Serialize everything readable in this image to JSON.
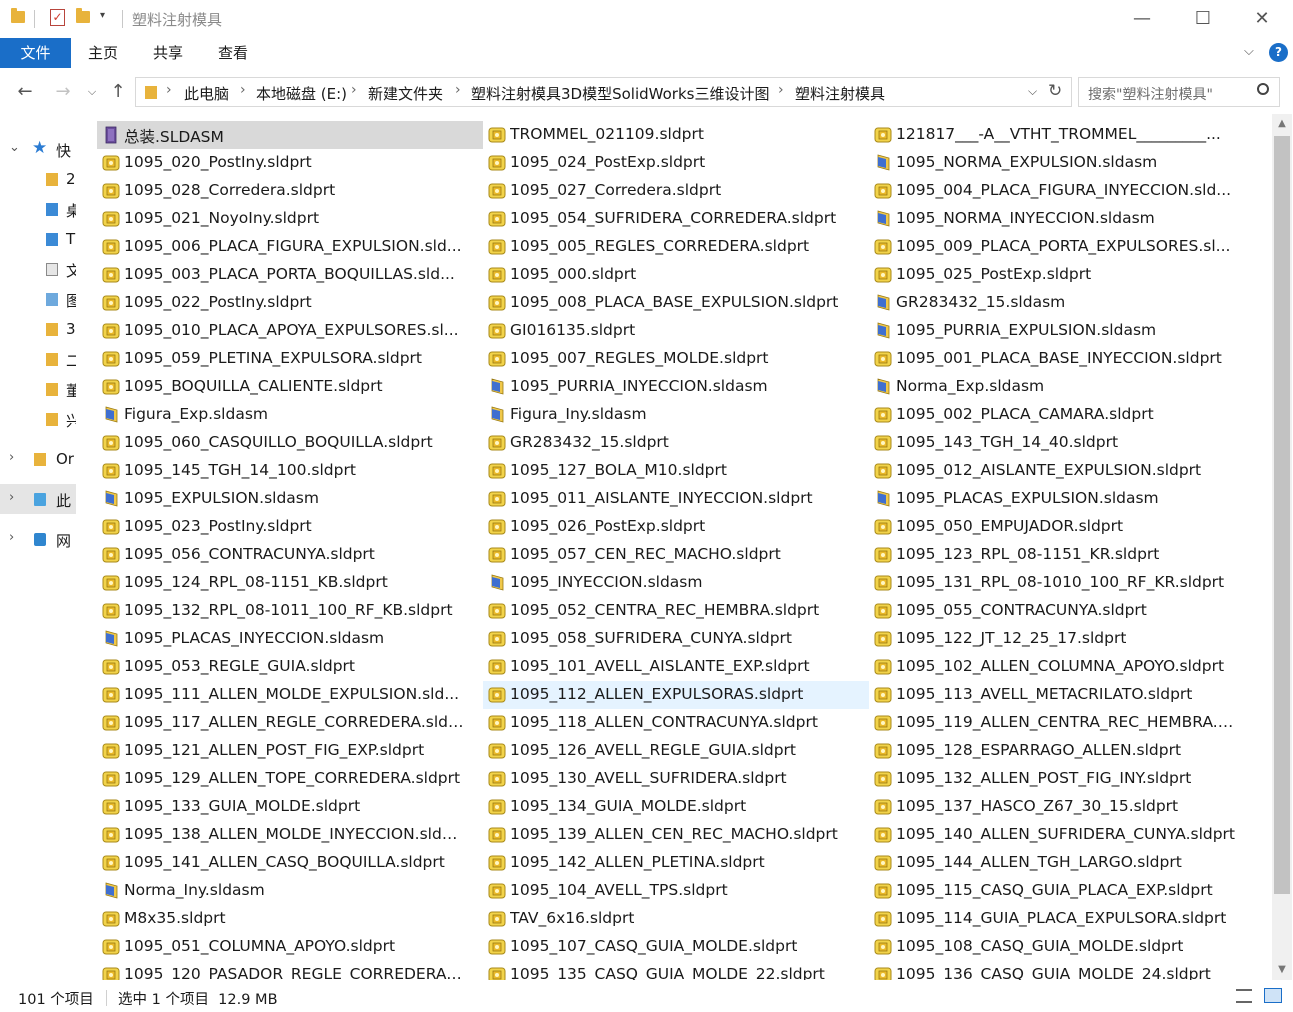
{
  "window": {
    "title": "塑料注射模具"
  },
  "ribbon": {
    "tabs": [
      "文件",
      "主页",
      "共享",
      "查看"
    ]
  },
  "address": {
    "crumbs": [
      "此电脑",
      "本地磁盘 (E:)",
      "新建文件夹",
      "塑料注射模具3D模型SolidWorks三维设计图",
      "塑料注射模具"
    ]
  },
  "search": {
    "placeholder": "搜索\"塑料注射模具\""
  },
  "navpane": {
    "items": [
      {
        "label": "快",
        "icon": "star-icon"
      },
      {
        "label": "2",
        "icon": "folder-icon"
      },
      {
        "label": "桌",
        "icon": "desktop-folder-icon"
      },
      {
        "label": "T",
        "icon": "download-folder-icon"
      },
      {
        "label": "文",
        "icon": "document-folder-icon"
      },
      {
        "label": "图",
        "icon": "picture-folder-icon"
      },
      {
        "label": "3",
        "icon": "folder-icon"
      },
      {
        "label": "二",
        "icon": "folder-icon"
      },
      {
        "label": "董",
        "icon": "folder-icon"
      },
      {
        "label": "兴",
        "icon": "folder-icon"
      },
      {
        "label": "Or",
        "icon": "folder-icon"
      },
      {
        "label": "此",
        "icon": "computer-icon"
      },
      {
        "label": "网",
        "icon": "network-icon"
      }
    ]
  },
  "files": [
    {
      "name": "总装.SLDASM",
      "kind": "top"
    },
    {
      "name": "TROMMEL_021109.sldprt",
      "kind": "part"
    },
    {
      "name": "121817___-A__VTHT_TROMMEL_________...",
      "kind": "part"
    },
    {
      "name": "1095_020_PostIny.sldprt",
      "kind": "part"
    },
    {
      "name": "1095_024_PostExp.sldprt",
      "kind": "part"
    },
    {
      "name": "1095_NORMA_EXPULSION.sldasm",
      "kind": "asm"
    },
    {
      "name": "1095_028_Corredera.sldprt",
      "kind": "part"
    },
    {
      "name": "1095_027_Corredera.sldprt",
      "kind": "part"
    },
    {
      "name": "1095_004_PLACA_FIGURA_INYECCION.sld...",
      "kind": "part"
    },
    {
      "name": "1095_021_NoyoIny.sldprt",
      "kind": "part"
    },
    {
      "name": "1095_054_SUFRIDERA_CORREDERA.sldprt",
      "kind": "part"
    },
    {
      "name": "1095_NORMA_INYECCION.sldasm",
      "kind": "asm"
    },
    {
      "name": "1095_006_PLACA_FIGURA_EXPULSION.sld...",
      "kind": "part"
    },
    {
      "name": "1095_005_REGLES_CORREDERA.sldprt",
      "kind": "part"
    },
    {
      "name": "1095_009_PLACA_PORTA_EXPULSORES.sl...",
      "kind": "part"
    },
    {
      "name": "1095_003_PLACA_PORTA_BOQUILLAS.sld...",
      "kind": "part"
    },
    {
      "name": "1095_000.sldprt",
      "kind": "part"
    },
    {
      "name": "1095_025_PostExp.sldprt",
      "kind": "part"
    },
    {
      "name": "1095_022_PostIny.sldprt",
      "kind": "part"
    },
    {
      "name": "1095_008_PLACA_BASE_EXPULSION.sldprt",
      "kind": "part"
    },
    {
      "name": "GR283432_15.sldasm",
      "kind": "asm"
    },
    {
      "name": "1095_010_PLACA_APOYA_EXPULSORES.sl...",
      "kind": "part"
    },
    {
      "name": "GI016135.sldprt",
      "kind": "part"
    },
    {
      "name": "1095_PURRIA_EXPULSION.sldasm",
      "kind": "asm"
    },
    {
      "name": "1095_059_PLETINA_EXPULSORA.sldprt",
      "kind": "part"
    },
    {
      "name": "1095_007_REGLES_MOLDE.sldprt",
      "kind": "part"
    },
    {
      "name": "1095_001_PLACA_BASE_INYECCION.sldprt",
      "kind": "part"
    },
    {
      "name": "1095_BOQUILLA_CALIENTE.sldprt",
      "kind": "part"
    },
    {
      "name": "1095_PURRIA_INYECCION.sldasm",
      "kind": "asm"
    },
    {
      "name": "Norma_Exp.sldasm",
      "kind": "asm"
    },
    {
      "name": "Figura_Exp.sldasm",
      "kind": "asm"
    },
    {
      "name": "Figura_Iny.sldasm",
      "kind": "asm"
    },
    {
      "name": "1095_002_PLACA_CAMARA.sldprt",
      "kind": "part"
    },
    {
      "name": "1095_060_CASQUILLO_BOQUILLA.sldprt",
      "kind": "part"
    },
    {
      "name": "GR283432_15.sldprt",
      "kind": "part"
    },
    {
      "name": "1095_143_TGH_14_40.sldprt",
      "kind": "part"
    },
    {
      "name": "1095_145_TGH_14_100.sldprt",
      "kind": "part"
    },
    {
      "name": "1095_127_BOLA_M10.sldprt",
      "kind": "part"
    },
    {
      "name": "1095_012_AISLANTE_EXPULSION.sldprt",
      "kind": "part"
    },
    {
      "name": "1095_EXPULSION.sldasm",
      "kind": "asm"
    },
    {
      "name": "1095_011_AISLANTE_INYECCION.sldprt",
      "kind": "part"
    },
    {
      "name": "1095_PLACAS_EXPULSION.sldasm",
      "kind": "asm"
    },
    {
      "name": "1095_023_PostIny.sldprt",
      "kind": "part"
    },
    {
      "name": "1095_026_PostExp.sldprt",
      "kind": "part"
    },
    {
      "name": "1095_050_EMPUJADOR.sldprt",
      "kind": "part"
    },
    {
      "name": "1095_056_CONTRACUNYA.sldprt",
      "kind": "part"
    },
    {
      "name": "1095_057_CEN_REC_MACHO.sldprt",
      "kind": "part"
    },
    {
      "name": "1095_123_RPL_08-1151_KR.sldprt",
      "kind": "part"
    },
    {
      "name": "1095_124_RPL_08-1151_KB.sldprt",
      "kind": "part"
    },
    {
      "name": "1095_INYECCION.sldasm",
      "kind": "asm"
    },
    {
      "name": "1095_131_RPL_08-1010_100_RF_KR.sldprt",
      "kind": "part"
    },
    {
      "name": "1095_132_RPL_08-1011_100_RF_KB.sldprt",
      "kind": "part"
    },
    {
      "name": "1095_052_CENTRA_REC_HEMBRA.sldprt",
      "kind": "part"
    },
    {
      "name": "1095_055_CONTRACUNYA.sldprt",
      "kind": "part"
    },
    {
      "name": "1095_PLACAS_INYECCION.sldasm",
      "kind": "asm"
    },
    {
      "name": "1095_058_SUFRIDERA_CUNYA.sldprt",
      "kind": "part"
    },
    {
      "name": "1095_122_JT_12_25_17.sldprt",
      "kind": "part"
    },
    {
      "name": "1095_053_REGLE_GUIA.sldprt",
      "kind": "part"
    },
    {
      "name": "1095_101_AVELL_AISLANTE_EXP.sldprt",
      "kind": "part"
    },
    {
      "name": "1095_102_ALLEN_COLUMNA_APOYO.sldprt",
      "kind": "part"
    },
    {
      "name": "1095_111_ALLEN_MOLDE_EXPULSION.sld...",
      "kind": "part"
    },
    {
      "name": "1095_112_ALLEN_EXPULSORAS.sldprt",
      "kind": "part",
      "state": "hover"
    },
    {
      "name": "1095_113_AVELL_METACRILATO.sldprt",
      "kind": "part"
    },
    {
      "name": "1095_117_ALLEN_REGLE_CORREDERA.sldprt",
      "kind": "part"
    },
    {
      "name": "1095_118_ALLEN_CONTRACUNYA.sldprt",
      "kind": "part"
    },
    {
      "name": "1095_119_ALLEN_CENTRA_REC_HEMBRA.s...",
      "kind": "part"
    },
    {
      "name": "1095_121_ALLEN_POST_FIG_EXP.sldprt",
      "kind": "part"
    },
    {
      "name": "1095_126_AVELL_REGLE_GUIA.sldprt",
      "kind": "part"
    },
    {
      "name": "1095_128_ESPARRAGO_ALLEN.sldprt",
      "kind": "part"
    },
    {
      "name": "1095_129_ALLEN_TOPE_CORREDERA.sldprt",
      "kind": "part"
    },
    {
      "name": "1095_130_AVELL_SUFRIDERA.sldprt",
      "kind": "part"
    },
    {
      "name": "1095_132_ALLEN_POST_FIG_INY.sldprt",
      "kind": "part"
    },
    {
      "name": "1095_133_GUIA_MOLDE.sldprt",
      "kind": "part"
    },
    {
      "name": "1095_134_GUIA_MOLDE.sldprt",
      "kind": "part"
    },
    {
      "name": "1095_137_HASCO_Z67_30_15.sldprt",
      "kind": "part"
    },
    {
      "name": "1095_138_ALLEN_MOLDE_INYECCION.sldprt",
      "kind": "part"
    },
    {
      "name": "1095_139_ALLEN_CEN_REC_MACHO.sldprt",
      "kind": "part"
    },
    {
      "name": "1095_140_ALLEN_SUFRIDERA_CUNYA.sldprt",
      "kind": "part"
    },
    {
      "name": "1095_141_ALLEN_CASQ_BOQUILLA.sldprt",
      "kind": "part"
    },
    {
      "name": "1095_142_ALLEN_PLETINA.sldprt",
      "kind": "part"
    },
    {
      "name": "1095_144_ALLEN_TGH_LARGO.sldprt",
      "kind": "part"
    },
    {
      "name": "Norma_Iny.sldasm",
      "kind": "asm"
    },
    {
      "name": "1095_104_AVELL_TPS.sldprt",
      "kind": "part"
    },
    {
      "name": "1095_115_CASQ_GUIA_PLACA_EXP.sldprt",
      "kind": "part"
    },
    {
      "name": "M8x35.sldprt",
      "kind": "part"
    },
    {
      "name": "TAV_6x16.sldprt",
      "kind": "part"
    },
    {
      "name": "1095_114_GUIA_PLACA_EXPULSORA.sldprt",
      "kind": "part"
    },
    {
      "name": "1095_051_COLUMNA_APOYO.sldprt",
      "kind": "part"
    },
    {
      "name": "1095_107_CASQ_GUIA_MOLDE.sldprt",
      "kind": "part"
    },
    {
      "name": "1095_108_CASQ_GUIA_MOLDE.sldprt",
      "kind": "part"
    },
    {
      "name": "1095_120_PASADOR_REGLE_CORREDERA....",
      "kind": "part"
    },
    {
      "name": "1095_135_CASQ_GUIA_MOLDE_22.sldprt",
      "kind": "part"
    },
    {
      "name": "1095_136_CASQ_GUIA_MOLDE_24.sldprt",
      "kind": "part"
    }
  ],
  "status": {
    "item_count": "101 个项目",
    "selection": "选中 1 个项目  12.9 MB"
  }
}
